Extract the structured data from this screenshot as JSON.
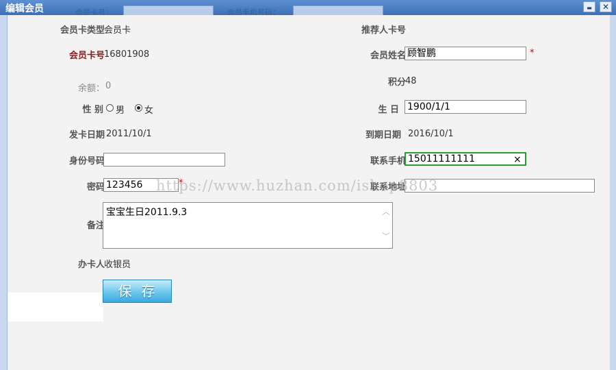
{
  "window": {
    "title": "编辑会员",
    "minimize_glyph": "▬",
    "close_glyph": "✕"
  },
  "background": {
    "field1_label": "会员卡号：",
    "field2_label": "会员手机号码："
  },
  "form": {
    "card_type": {
      "label": "会员卡类型",
      "value": "会员卡"
    },
    "referrer_card": {
      "label": "推荐人卡号",
      "value": ""
    },
    "card_no": {
      "label": "会员卡号",
      "value": "16801908"
    },
    "member_name": {
      "label": "会员姓名",
      "value": "顾智鹏",
      "required": "*"
    },
    "balance": {
      "label": "余额：",
      "value": "0"
    },
    "points": {
      "label": "积分",
      "value": "48"
    },
    "gender": {
      "label": "性 别",
      "options": [
        "男",
        "女"
      ],
      "selected": "女"
    },
    "birthday": {
      "label": "生 日",
      "value": "1900/1/1"
    },
    "issue_date": {
      "label": "发卡日期",
      "value": "2011/10/1"
    },
    "expire_date": {
      "label": "到期日期",
      "value": "2016/10/1"
    },
    "id_number": {
      "label": "身份号码",
      "value": ""
    },
    "mobile": {
      "label": "联系手机",
      "value": "15011111111",
      "clear_glyph": "×"
    },
    "password": {
      "label": "密码",
      "value": "123456",
      "required": "*"
    },
    "address": {
      "label": "联系地址",
      "value": ""
    },
    "remark": {
      "label": "备注",
      "value": "宝宝生日2011.9.3"
    },
    "operator": {
      "label": "办卡人",
      "value": "收银员"
    }
  },
  "save_button": {
    "label": "保存"
  },
  "watermark": "https://www.huzhan.com/ishop8803",
  "colors": {
    "accent_green": "#2e9b2e",
    "required_red": "#cc0000",
    "save_blue": "#3aa9dc"
  },
  "icons": [
    "minimize-icon",
    "close-icon",
    "clear-icon",
    "scroll-up-icon",
    "scroll-down-icon"
  ]
}
